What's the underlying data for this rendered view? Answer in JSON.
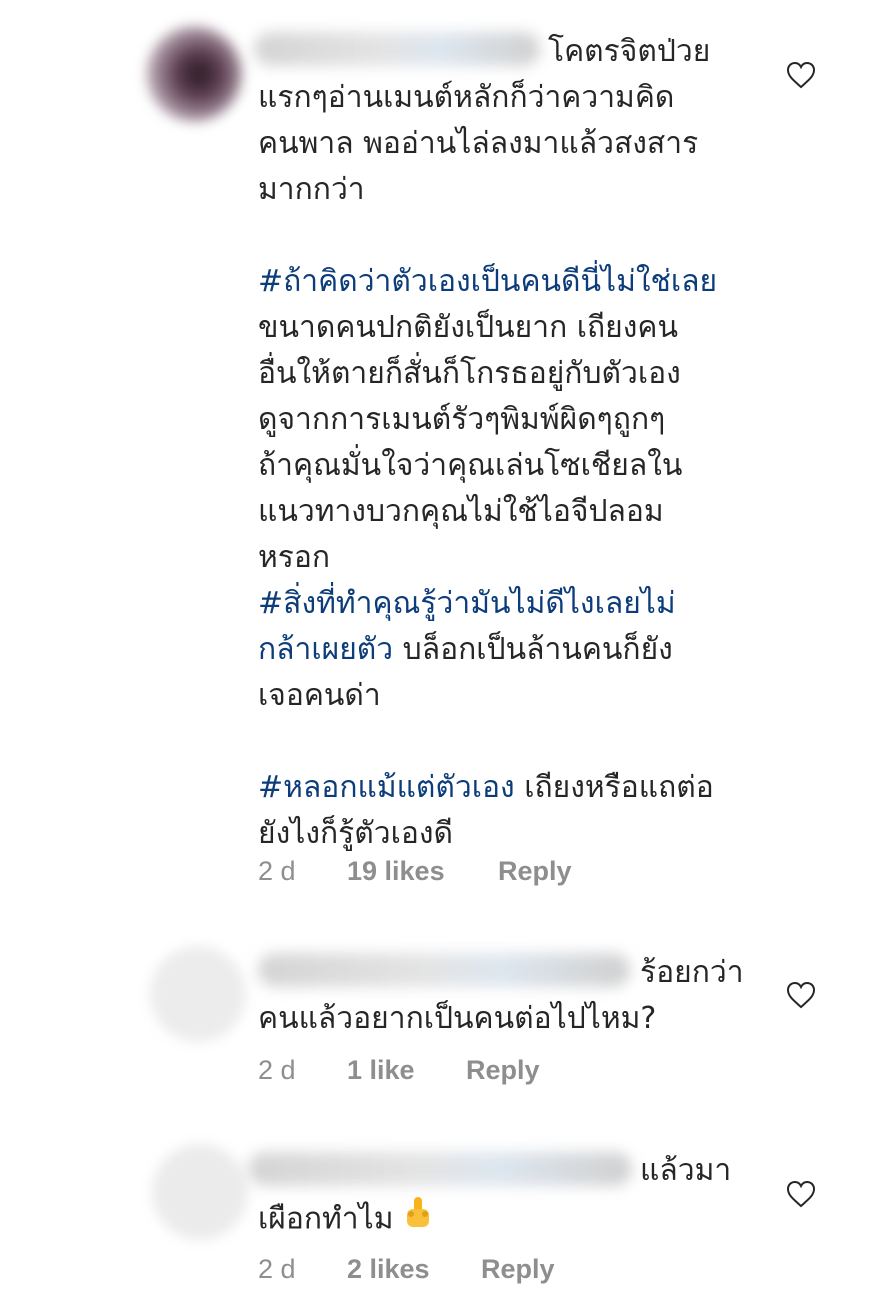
{
  "comments": [
    {
      "first_line": "โคตรจิตป่วย",
      "body_1": "แรกๆอ่านเมนต์หลักก็ว่าความคิด\nคนพาล พออ่านไล่ลงมาแล้วสงสาร\nมากกว่า",
      "hashtag_1": "#ถ้าคิดว่าตัวเองเป็นคนดีนี่ไม่ใช่เลย",
      "body_2": "ขนาดคนปกติยังเป็นยาก เถียงคน\nอื่นให้ตายก็สั่นก็โกรธอยู่กับตัวเอง\nดูจากการเมนต์รัวๆพิมพ์ผิดๆถูกๆ\nถ้าคุณมั่นใจว่าคุณเล่นโซเชียลใน\nแนวทางบวกคุณไม่ใช้ไอจีปลอม\nหรอก",
      "hashtag_2": "#สิ่งที่ทำคุณรู้ว่ามันไม่ดีไงเลยไม่\nกล้าเผยตัว",
      "body_3": " บล็อกเป็นล้านคนก็ยัง\nเจอคนด่า",
      "hashtag_3": "#หลอกแม้แต่ตัวเอง",
      "body_4": " เถียงหรือแถต่อ\nยังไงก็รู้ตัวเองดี",
      "time": "2 d",
      "likes": "19 likes",
      "reply": "Reply"
    },
    {
      "first_line": "ร้อยกว่า",
      "body": "คนแล้วอยากเป็นคนต่อไปไหม?",
      "time": "2 d",
      "likes": "1 like",
      "reply": "Reply"
    },
    {
      "first_line": "แล้วมา",
      "body": "เผือกทำไม",
      "emoji": "middle-finger-emoji",
      "time": "2 d",
      "likes": "2 likes",
      "reply": "Reply"
    }
  ],
  "icons": {
    "like": "heart-outline-icon"
  },
  "colors": {
    "text": "#262626",
    "hashtag": "#0d3c7a",
    "meta": "#8e8e8e"
  }
}
